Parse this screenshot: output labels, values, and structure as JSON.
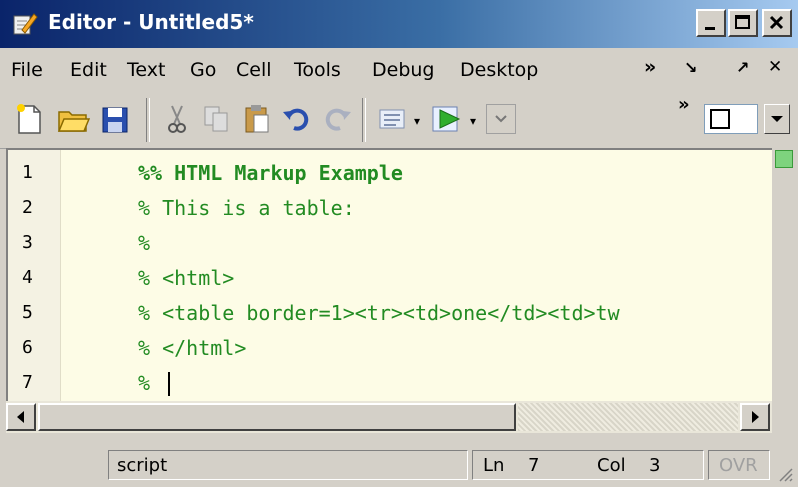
{
  "window": {
    "title": "Editor - Untitled5*"
  },
  "menu": {
    "items": [
      "File",
      "Edit",
      "Text",
      "Go",
      "Cell",
      "Tools",
      "Debug",
      "Desktop"
    ],
    "right_items": [
      "»",
      "↘",
      "↗",
      "✕"
    ]
  },
  "toolbar": {
    "buttons": [
      "new-file-icon",
      "open-folder-icon",
      "save-icon",
      "cut-icon",
      "copy-icon",
      "paste-icon",
      "undo-icon",
      "redo-icon",
      "cell-mode-icon",
      "run-icon"
    ],
    "overflow": "»"
  },
  "editor": {
    "lines": [
      {
        "n": "1",
        "text": "%% HTML Markup Example"
      },
      {
        "n": "2",
        "text": "% This is a table:"
      },
      {
        "n": "3",
        "text": "%"
      },
      {
        "n": "4",
        "text": "% <html>"
      },
      {
        "n": "5",
        "text": "% <table border=1><tr><td>one</td><td>tw"
      },
      {
        "n": "6",
        "text": "% </html>"
      },
      {
        "n": "7",
        "text": "%"
      }
    ]
  },
  "status": {
    "mode": "script",
    "ln_label": "Ln",
    "ln_value": "7",
    "col_label": "Col",
    "col_value": "3",
    "ovr": "OVR"
  },
  "colors": {
    "comment": "#228b22",
    "editor_bg": "#fdfce6",
    "title_start": "#0a246a",
    "title_end": "#a6caf0"
  }
}
